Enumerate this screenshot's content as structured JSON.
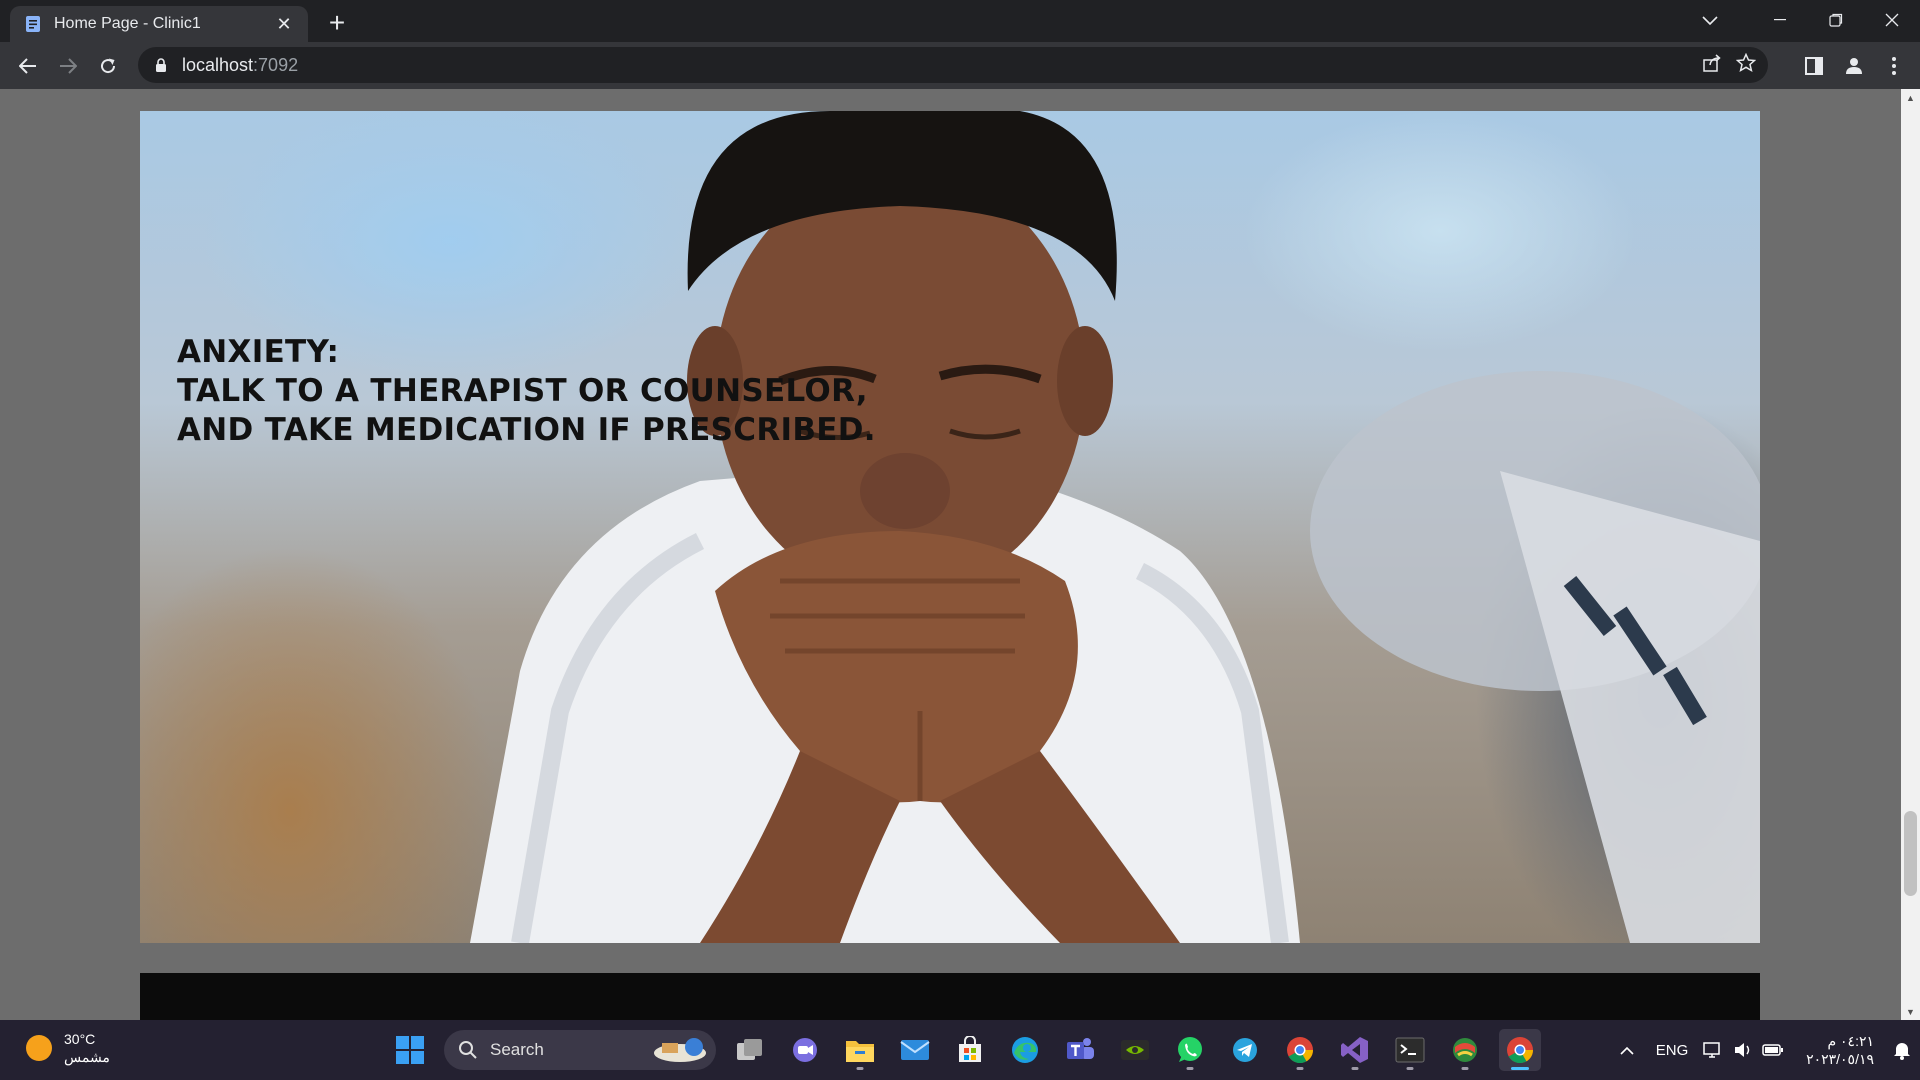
{
  "browser": {
    "tab_title": "Home Page - Clinic1",
    "url_host": "localhost",
    "url_rest": ":7092"
  },
  "page": {
    "hero_lines": [
      "ANXIETY:",
      "TALK TO A THERAPIST OR COUNSELOR,",
      "AND TAKE MEDICATION IF PRESCRIBED."
    ]
  },
  "taskbar": {
    "weather_temp": "30°C",
    "weather_desc": "مشمس",
    "search_label": "Search",
    "language": "ENG",
    "clock_time": "٠٤:٢١ م",
    "clock_date": "٢٠٢٣/٠٥/١٩",
    "pinned_apps": [
      "start-icon",
      "search",
      "task-view-icon",
      "chat-icon",
      "file-explorer-icon",
      "mail-icon",
      "store-icon",
      "edge-icon",
      "teams-icon",
      "nvidia-icon",
      "whatsapp-icon",
      "telegram-icon",
      "chrome-icon",
      "visual-studio-icon",
      "terminal-icon",
      "app-icon",
      "chrome-active-icon"
    ]
  },
  "colors": {
    "chrome_dark": "#202124",
    "chrome_toolbar": "#35363a",
    "taskbar": "#242131",
    "active_indicator": "#4cc2ff"
  }
}
